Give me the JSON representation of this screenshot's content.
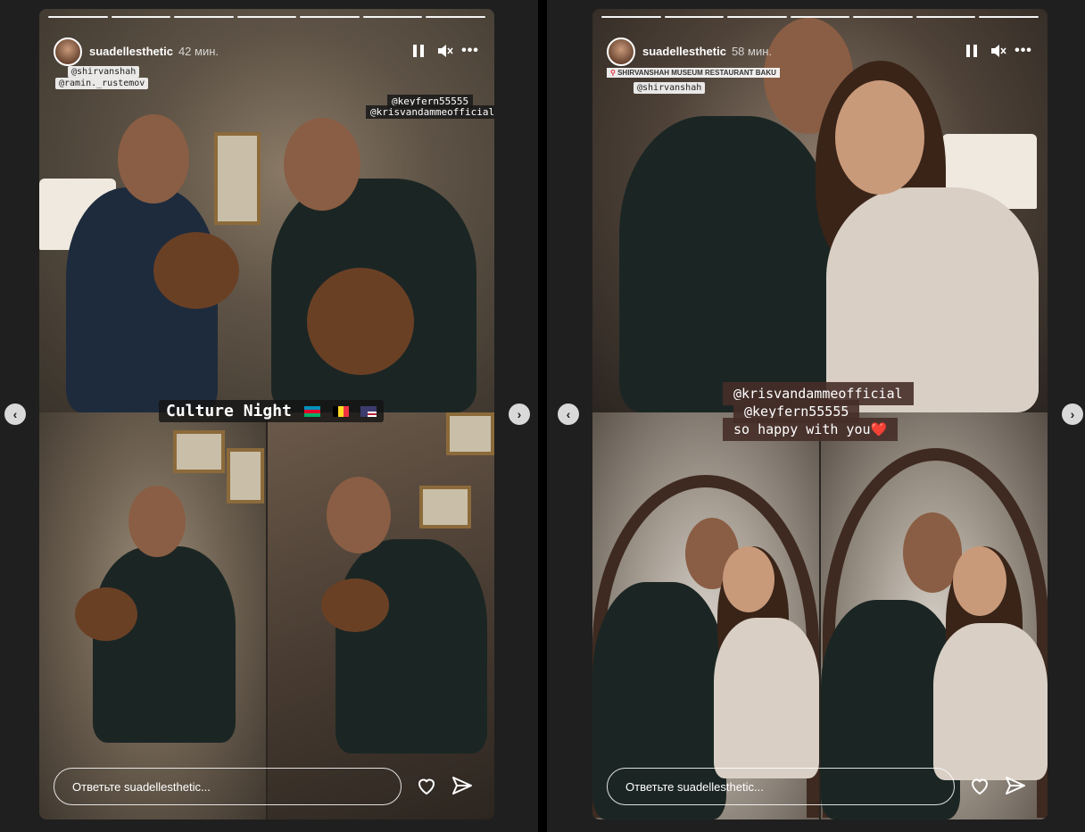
{
  "stories": [
    {
      "username": "suadellesthetic",
      "time": "42 мин.",
      "reply_placeholder": "Ответьте suadellesthetic...",
      "tags": {
        "top_left_1": "@shirvanshah",
        "top_left_2": "@ramin._rustemov",
        "top_right_1": "@keyfern55555",
        "top_right_2": "@krisvandammeofficial"
      },
      "heart_emoji": "❤",
      "culture_label": "Culture Night",
      "flags": [
        "azerbaijan-flag",
        "belgium-flag",
        "usa-flag"
      ]
    },
    {
      "username": "suadellesthetic",
      "time": "58 мин.",
      "reply_placeholder": "Ответьте suadellesthetic...",
      "location": "SHIRVANSHAH MUSEUM RESTAURANT BAKU",
      "tags": {
        "top_left_1": "@shirvanshah"
      },
      "caption": {
        "line1": "@krisvandammeofficial",
        "line2": "@keyfern55555",
        "line3": "so happy with you❤️"
      }
    }
  ],
  "colors": {
    "background": "#1f1f1f",
    "divider": "#000000",
    "caption_bg": "#462d28",
    "flag_az_blue": "#0092bc",
    "flag_az_red": "#e4002b",
    "flag_az_green": "#00af66"
  }
}
